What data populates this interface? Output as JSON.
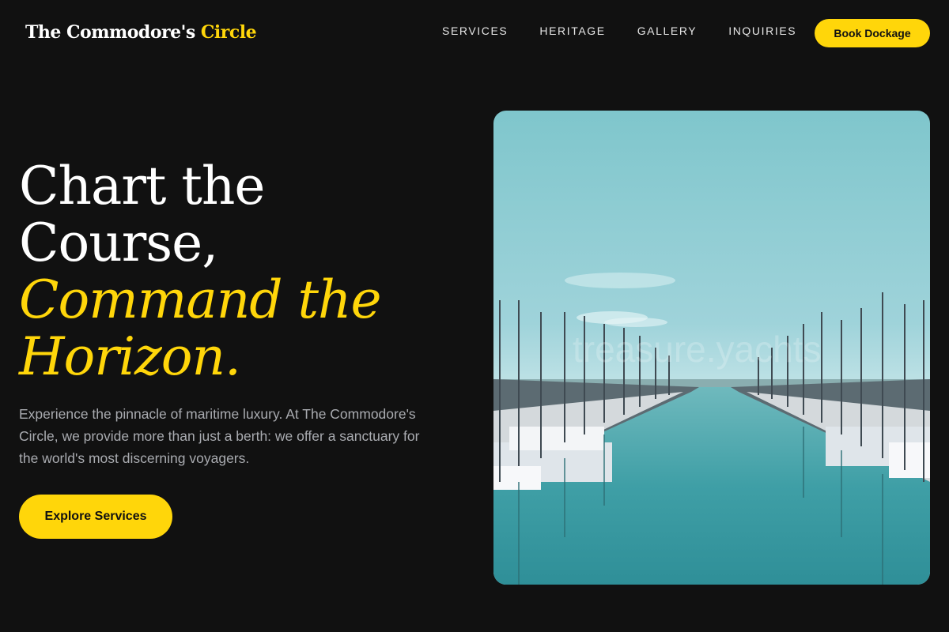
{
  "header": {
    "logo_main": "The Commodore's",
    "logo_accent": "Circle",
    "nav": [
      "SERVICES",
      "HERITAGE",
      "GALLERY",
      "INQUIRIES"
    ],
    "cta_label": "Book Dockage"
  },
  "hero": {
    "title_line1": "Chart the",
    "title_line2": "Course,",
    "title_line3": "Command the",
    "title_line4": "Horizon.",
    "description": "Experience the pinnacle of maritime luxury. At The Commodore's Circle, we provide more than just a berth: we offer a sanctuary for the world's most discerning voyagers.",
    "cta_label": "Explore Services",
    "image_watermark": "treasure.yachts"
  },
  "colors": {
    "background": "#111111",
    "accent": "#FFD60A",
    "text_muted": "#a9abb0"
  }
}
